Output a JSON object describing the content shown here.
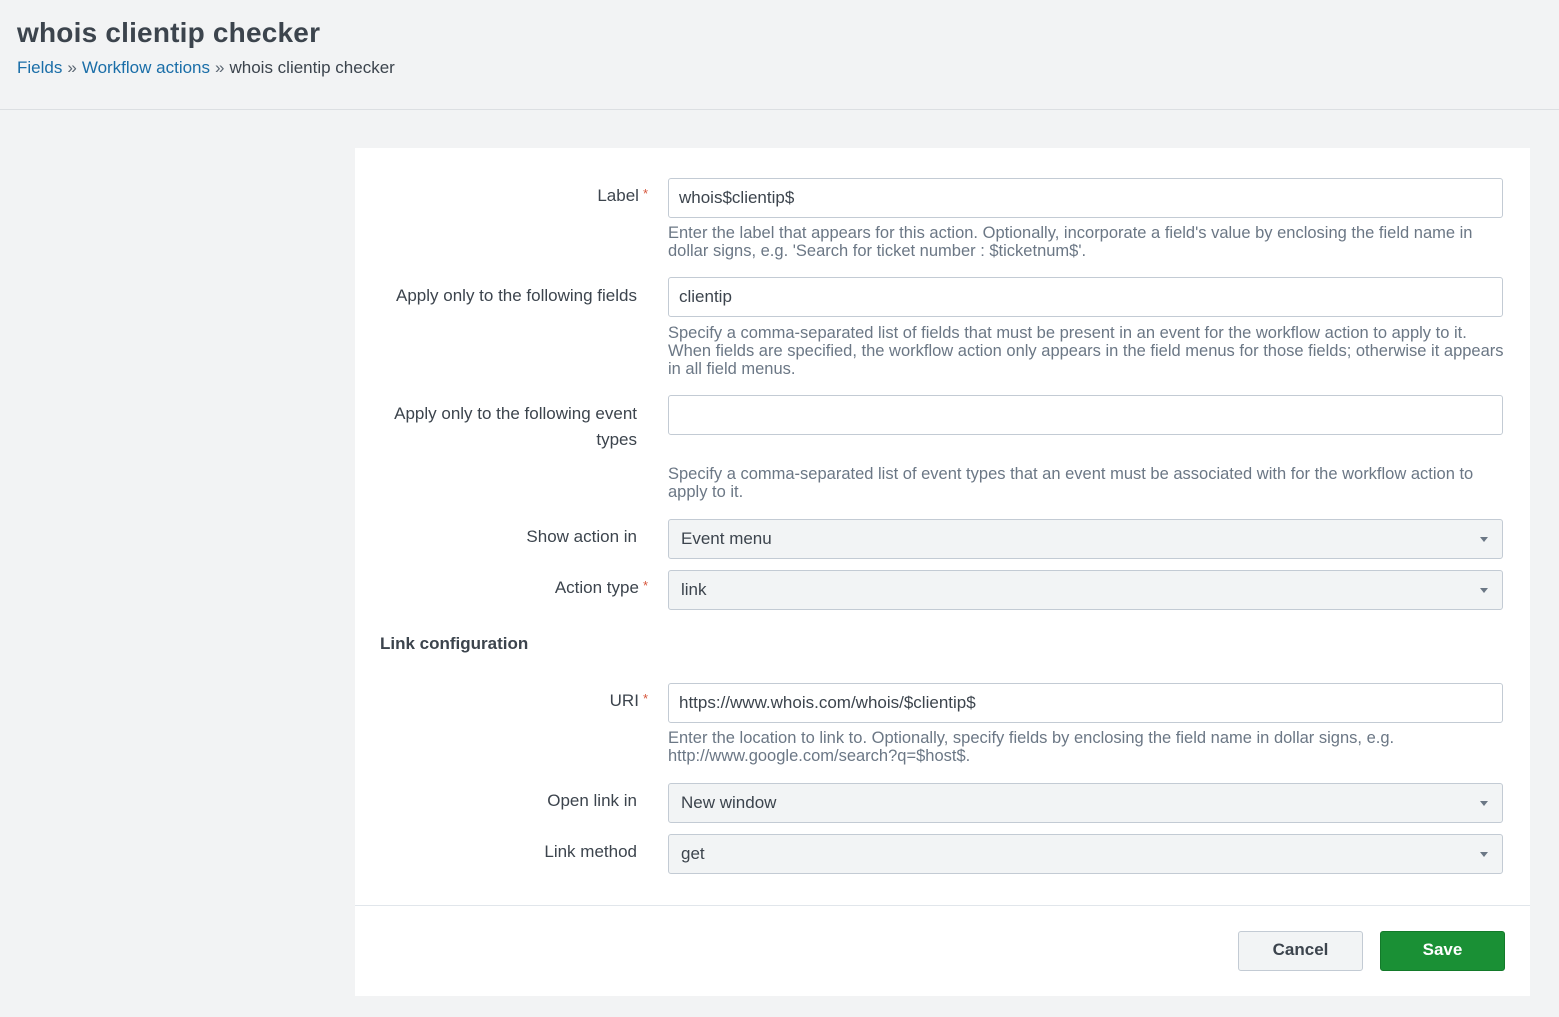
{
  "header": {
    "title": "whois clientip checker",
    "breadcrumb": {
      "fields": "Fields",
      "separator": "»",
      "workflow_actions": "Workflow actions",
      "current": "whois clientip checker"
    }
  },
  "form": {
    "required_marker": "*",
    "label": {
      "label": "Label",
      "value": "whois$clientip$",
      "help": "Enter the label that appears for this action. Optionally, incorporate a field's value by enclosing the field name in dollar signs, e.g. 'Search for ticket number : $ticketnum$'."
    },
    "fields": {
      "label": "Apply only to the following fields",
      "value": "clientip",
      "help": "Specify a comma-separated list of fields that must be present in an event for the workflow action to apply to it. When fields are specified, the workflow action only appears in the field menus for those fields; otherwise it appears in all field menus."
    },
    "event_types": {
      "label_line1": "Apply only to the following event",
      "label_line2": "types",
      "value": "",
      "help": "Specify a comma-separated list of event types that an event must be associated with for the workflow action to apply to it."
    },
    "show_action_in": {
      "label": "Show action in",
      "value": "Event menu"
    },
    "action_type": {
      "label": "Action type",
      "value": "link"
    },
    "link_section_title": "Link configuration",
    "uri": {
      "label": "URI",
      "value": "https://www.whois.com/whois/$clientip$",
      "help": "Enter the location to link to. Optionally, specify fields by enclosing the field name in dollar signs, e.g. http://www.google.com/search?q=$host$."
    },
    "open_link_in": {
      "label": "Open link in",
      "value": "New window"
    },
    "link_method": {
      "label": "Link method",
      "value": "get"
    }
  },
  "footer": {
    "cancel_label": "Cancel",
    "save_label": "Save"
  },
  "colors": {
    "link": "#1a6ea8",
    "required": "#d6563c",
    "save_button": "#1a9035",
    "background": "#f2f3f4"
  }
}
